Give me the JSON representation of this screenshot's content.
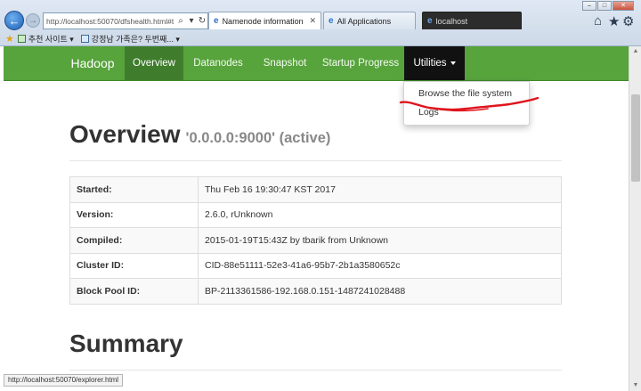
{
  "browser": {
    "address": "http://localhost:50070/dfshealth.html#t",
    "tabs": [
      {
        "label": "Namenode information",
        "active": true
      },
      {
        "label": "All Applications",
        "active": false
      },
      {
        "label": "localhost",
        "active": false
      }
    ],
    "favorites": [
      {
        "label": "추천 사이트 ▾"
      },
      {
        "label": "강정남 가족은? 두번째... ▾"
      }
    ],
    "window_controls": {
      "minimize": "–",
      "maximize": "□",
      "close": "✕"
    },
    "status_text": "http://localhost:50070/explorer.html"
  },
  "navbar": {
    "brand": "Hadoop",
    "items": [
      {
        "label": "Overview",
        "active": true
      },
      {
        "label": "Datanodes"
      },
      {
        "label": "Snapshot"
      },
      {
        "label": "Startup Progress"
      },
      {
        "label": "Utilities",
        "open": true
      }
    ],
    "dropdown": [
      {
        "label": "Browse the file system"
      },
      {
        "label": "Logs"
      }
    ]
  },
  "overview": {
    "title": "Overview",
    "subtitle": "'0.0.0.0:9000' (active)",
    "rows": [
      {
        "key": "Started:",
        "value": "Thu Feb 16 19:30:47 KST 2017"
      },
      {
        "key": "Version:",
        "value": "2.6.0, rUnknown"
      },
      {
        "key": "Compiled:",
        "value": "2015-01-19T15:43Z by tbarik from Unknown"
      },
      {
        "key": "Cluster ID:",
        "value": "CID-88e51111-52e3-41a6-95b7-2b1a3580652c"
      },
      {
        "key": "Block Pool ID:",
        "value": "BP-2113361586-192.168.0.151-1487241028488"
      }
    ]
  },
  "summary": {
    "title": "Summary"
  },
  "colors": {
    "navbar": "#57a33c",
    "navbar_active": "#3f7d2d",
    "utilities_active": "#111111",
    "annotation": "#e0141e"
  }
}
